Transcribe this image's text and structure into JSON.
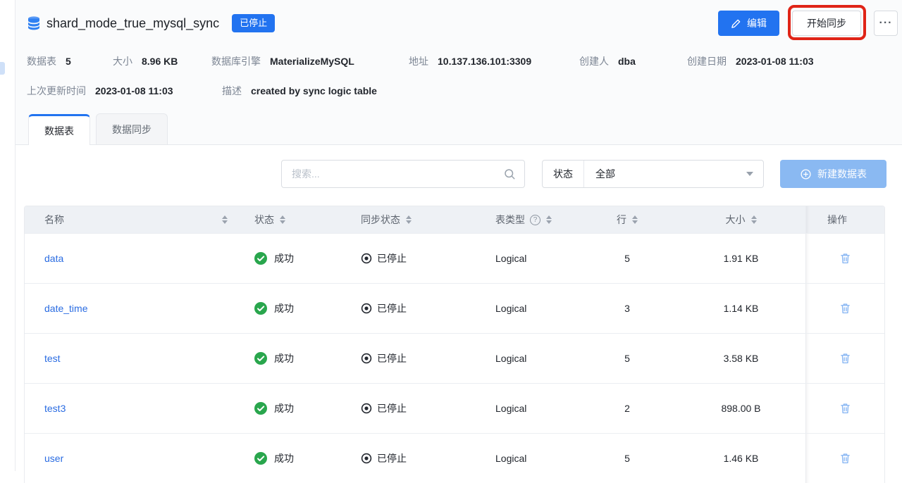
{
  "header": {
    "title": "shard_mode_true_mysql_sync",
    "status_badge": "已停止",
    "edit_label": "编辑",
    "start_sync_label": "开始同步",
    "more_label": "···"
  },
  "meta": {
    "row1": [
      {
        "label": "数据表",
        "value": "5"
      },
      {
        "label": "大小",
        "value": "8.96 KB"
      },
      {
        "label": "数据库引擎",
        "value": "MaterializeMySQL"
      },
      {
        "label": "地址",
        "value": "10.137.136.101:3309"
      },
      {
        "label": "创建人",
        "value": "dba"
      },
      {
        "label": "创建日期",
        "value": "2023-01-08 11:03"
      }
    ],
    "row2": [
      {
        "label": "上次更新时间",
        "value": "2023-01-08 11:03"
      },
      {
        "label": "描述",
        "value": "created by sync logic table"
      }
    ]
  },
  "tabs": [
    {
      "label": "数据表",
      "active": true
    },
    {
      "label": "数据同步",
      "active": false
    }
  ],
  "toolbar": {
    "search_placeholder": "搜索...",
    "filter_label": "状态",
    "filter_value": "全部",
    "create_label": "新建数据表"
  },
  "table": {
    "columns": [
      {
        "label": "名称",
        "sortable": true
      },
      {
        "label": "状态",
        "sortable": true
      },
      {
        "label": "同步状态",
        "sortable": true
      },
      {
        "label": "表类型",
        "sortable": true,
        "help": true
      },
      {
        "label": "行",
        "sortable": true
      },
      {
        "label": "大小",
        "sortable": true
      },
      {
        "label": "操作",
        "sortable": false
      }
    ],
    "rows": [
      {
        "name": "data",
        "status": "成功",
        "sync_status": "已停止",
        "type": "Logical",
        "rows": "5",
        "size": "1.91 KB"
      },
      {
        "name": "date_time",
        "status": "成功",
        "sync_status": "已停止",
        "type": "Logical",
        "rows": "3",
        "size": "1.14 KB"
      },
      {
        "name": "test",
        "status": "成功",
        "sync_status": "已停止",
        "type": "Logical",
        "rows": "5",
        "size": "3.58 KB"
      },
      {
        "name": "test3",
        "status": "成功",
        "sync_status": "已停止",
        "type": "Logical",
        "rows": "2",
        "size": "898.00 B"
      },
      {
        "name": "user",
        "status": "成功",
        "sync_status": "已停止",
        "type": "Logical",
        "rows": "5",
        "size": "1.46 KB"
      }
    ]
  },
  "icons": {
    "help_glyph": "?"
  },
  "colors": {
    "primary_blue": "#2273f0",
    "create_button_blue": "#8ab9f2",
    "success_green": "#29a64d",
    "link_blue": "#2a6ce2",
    "annotation_red": "#e02417",
    "table_header_bg": "#eef1f5"
  }
}
